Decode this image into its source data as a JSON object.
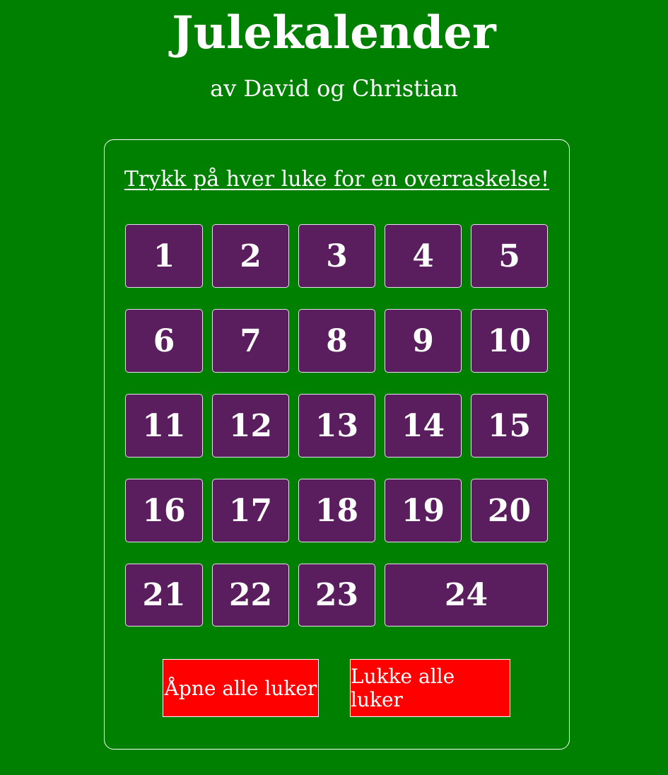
{
  "header": {
    "title": "Julekalender",
    "subtitle": "av David og Christian"
  },
  "calendar": {
    "instruction": "Trykk på hver luke for en overraskelse!",
    "doors": [
      "1",
      "2",
      "3",
      "4",
      "5",
      "6",
      "7",
      "8",
      "9",
      "10",
      "11",
      "12",
      "13",
      "14",
      "15",
      "16",
      "17",
      "18",
      "19",
      "20",
      "21",
      "22",
      "23",
      "24"
    ]
  },
  "actions": {
    "open_all_label": "Åpne alle luker",
    "close_all_label": "Lukke alle luker"
  },
  "colors": {
    "background": "#008000",
    "door": "#5a1e5e",
    "button": "#ff0000",
    "text": "#ffffff"
  }
}
